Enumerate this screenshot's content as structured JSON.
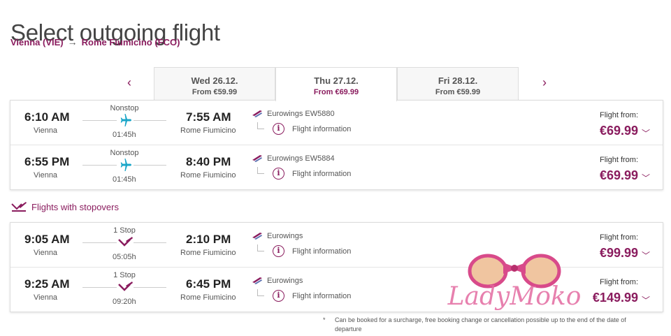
{
  "page": {
    "title": "Select outgoing flight",
    "origin": "Vienna  (VIE)",
    "destination": "Rome Fiumicino  (FCO)"
  },
  "dates": [
    {
      "date": "Wed 26.12.",
      "from": "From €59.99",
      "active": false
    },
    {
      "date": "Thu 27.12.",
      "from": "From €69.99",
      "active": true
    },
    {
      "date": "Fri 28.12.",
      "from": "From €59.99",
      "active": false
    }
  ],
  "labels": {
    "flight_from": "Flight from:",
    "flight_info": "Flight information",
    "stopovers_heading": "Flights with stopovers"
  },
  "direct_flights": [
    {
      "dep_time": "6:10 AM",
      "dep_city": "Vienna",
      "stops": "Nonstop",
      "duration": "01:45h",
      "arr_time": "7:55 AM",
      "arr_city": "Rome Fiumicino",
      "airline": "Eurowings  EW5880",
      "price": "€69.99"
    },
    {
      "dep_time": "6:55 PM",
      "dep_city": "Vienna",
      "stops": "Nonstop",
      "duration": "01:45h",
      "arr_time": "8:40 PM",
      "arr_city": "Rome Fiumicino",
      "airline": "Eurowings  EW5884",
      "price": "€69.99"
    }
  ],
  "stopover_flights": [
    {
      "dep_time": "9:05 AM",
      "dep_city": "Vienna",
      "stops": "1 Stop",
      "duration": "05:05h",
      "arr_time": "2:10 PM",
      "arr_city": "Rome Fiumicino",
      "airline": "Eurowings",
      "price": "€99.99"
    },
    {
      "dep_time": "9:25 AM",
      "dep_city": "Vienna",
      "stops": "1 Stop",
      "duration": "09:20h",
      "arr_time": "6:45 PM",
      "arr_city": "Rome Fiumicino",
      "airline": "Eurowings",
      "price": "€149.99"
    }
  ],
  "footnote": {
    "mark": "*",
    "text": "Can be booked for a surcharge, free booking change or cancellation possible up to the end of the date of departure"
  },
  "watermark": {
    "text": "LadyMoko"
  },
  "colors": {
    "brand": "#8a1c5e",
    "plane": "#1aa6c8"
  }
}
